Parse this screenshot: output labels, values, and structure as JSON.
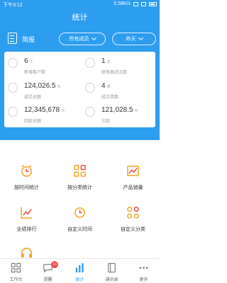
{
  "status_bar": {
    "time": "下午3:12",
    "network": "5.58K/s"
  },
  "header": {
    "title": "统计"
  },
  "filter": {
    "label": "简报",
    "member_select": "所有成员",
    "date_select": "昨天"
  },
  "stats": [
    {
      "value": "6",
      "unit": "个",
      "label": "新增客户数",
      "icon": "user-icon"
    },
    {
      "value": "1",
      "unit": "次",
      "label": "联系跟进次数",
      "icon": "contact-icon"
    },
    {
      "value": "124,026.5",
      "unit": "元",
      "label": "成交总额",
      "icon": "money-icon"
    },
    {
      "value": "4",
      "unit": "单",
      "label": "成交单数",
      "icon": "handshake-icon"
    },
    {
      "value": "12,345,678",
      "unit": "元",
      "label": "回款总额",
      "icon": "refund-icon"
    },
    {
      "value": "121,028.5",
      "unit": "元",
      "label": "欠款",
      "icon": "debt-icon"
    }
  ],
  "grid": [
    {
      "label": "按时间统计",
      "icon": "clock-icon"
    },
    {
      "label": "按分类统计",
      "icon": "category-icon"
    },
    {
      "label": "产品销量",
      "icon": "image-chart-icon"
    },
    {
      "label": "业绩排行",
      "icon": "line-chart-icon"
    },
    {
      "label": "自定义时间",
      "icon": "custom-time-icon"
    },
    {
      "label": "自定义分类",
      "icon": "custom-category-icon"
    },
    {
      "label": "",
      "icon": "headset-icon"
    }
  ],
  "tabbar": [
    {
      "label": "工作台",
      "icon": "workbench-icon"
    },
    {
      "label": "提醒",
      "icon": "message-icon",
      "badge": "13"
    },
    {
      "label": "统计",
      "icon": "bar-chart-icon",
      "active": true
    },
    {
      "label": "通讯录",
      "icon": "contacts-icon"
    },
    {
      "label": "更多",
      "icon": "more-icon"
    }
  ],
  "colors": {
    "primary": "#2d9df0",
    "accent": "#f5a623",
    "badge": "#f04848"
  }
}
